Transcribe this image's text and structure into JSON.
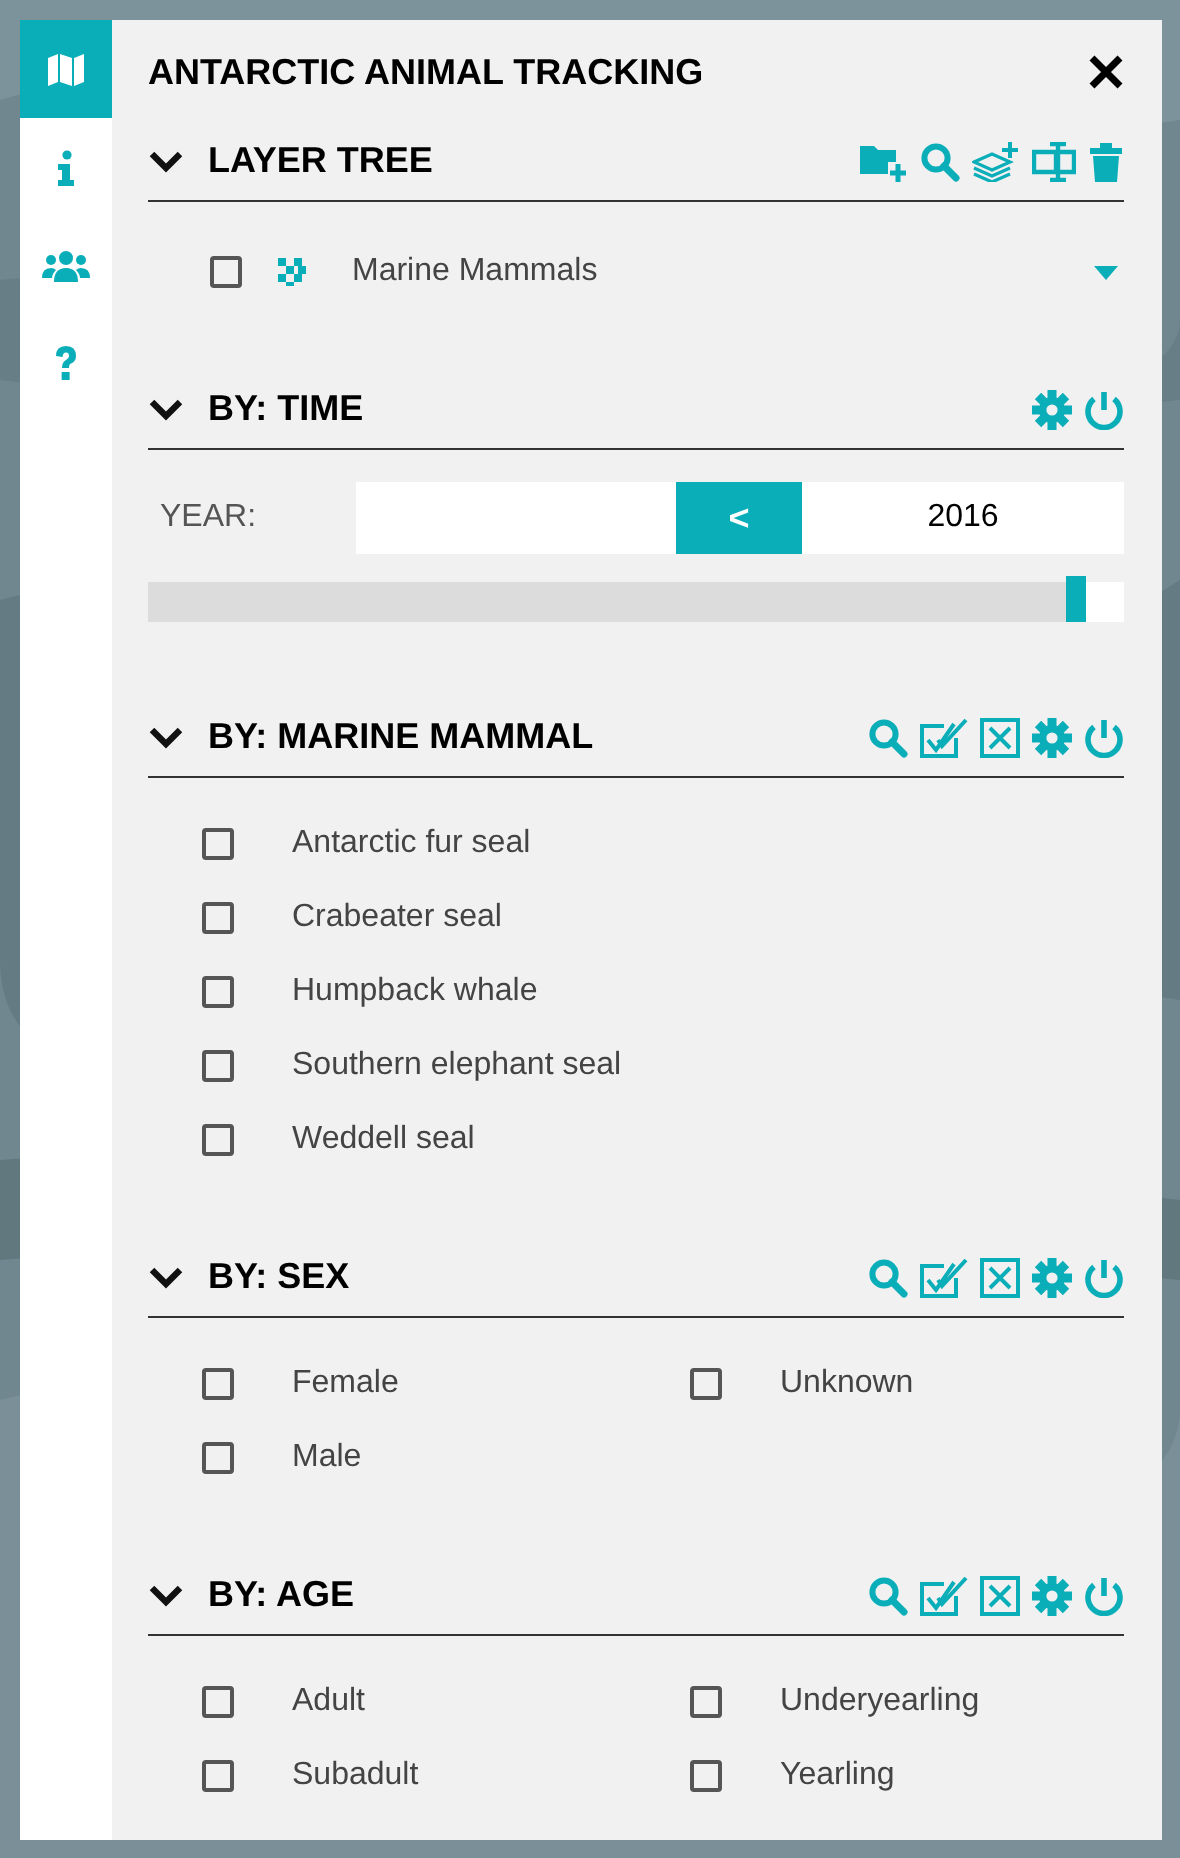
{
  "sidebar": {
    "items": [
      {
        "kind": "map",
        "selected": true
      },
      {
        "kind": "info",
        "selected": false
      },
      {
        "kind": "users",
        "selected": false
      },
      {
        "kind": "help",
        "selected": false
      }
    ]
  },
  "panel": {
    "title": "ANTARCTIC ANIMAL TRACKING"
  },
  "sections": [
    {
      "kind": "layers",
      "title": "LAYER TREE",
      "expanded": true,
      "layers": [
        {
          "label": "Marine Mammals",
          "checked": false
        }
      ]
    },
    {
      "kind": "time",
      "title": "BY: TIME",
      "expanded": true,
      "year_label": "YEAR:",
      "prev_button": "<",
      "year": "2016",
      "level": 0.95
    },
    {
      "kind": "filter_list",
      "title": "BY: MARINE MAMMAL",
      "expanded": true,
      "options": [
        {
          "label": "Antarctic fur seal",
          "checked": false
        },
        {
          "label": "Crabeater seal",
          "checked": false
        },
        {
          "label": "Humpback whale",
          "checked": false
        },
        {
          "label": "Southern elephant seal",
          "checked": false
        },
        {
          "label": "Weddell seal",
          "checked": false
        }
      ]
    },
    {
      "kind": "filter_grid",
      "title": "BY: SEX",
      "expanded": true,
      "options": [
        {
          "label": "Female",
          "checked": false
        },
        {
          "label": "Unknown",
          "checked": false
        },
        {
          "label": "Male",
          "checked": false
        }
      ]
    },
    {
      "kind": "filter_grid",
      "title": "BY: AGE",
      "expanded": true,
      "options": [
        {
          "label": "Adult",
          "checked": false
        },
        {
          "label": "Underyearling",
          "checked": false
        },
        {
          "label": "Subadult",
          "checked": false
        },
        {
          "label": "Yearling",
          "checked": false
        }
      ]
    }
  ]
}
